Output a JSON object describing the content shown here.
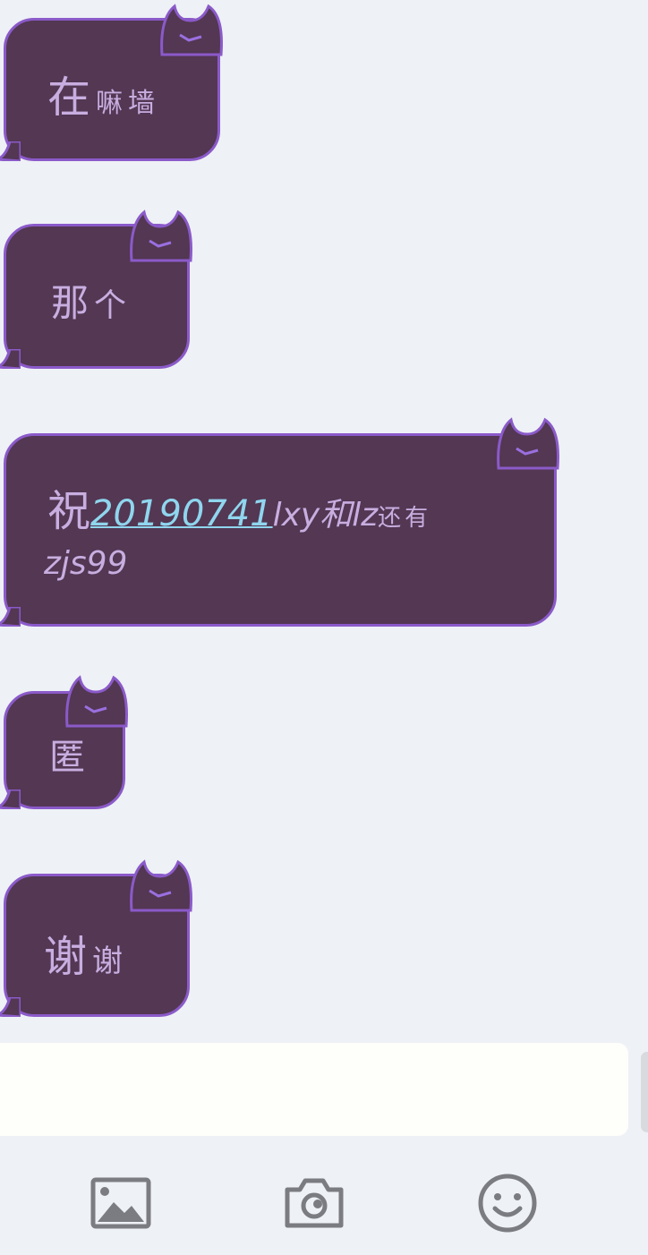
{
  "messages": [
    {
      "id": "m1",
      "big": "在",
      "small": "嘛墙"
    },
    {
      "id": "m2",
      "big": "那",
      "small": "个"
    },
    {
      "id": "m3",
      "big": "祝",
      "link": "20190741",
      "mid": "lxy和lz",
      "small": "还有",
      "line2": "zjs99"
    },
    {
      "id": "m4",
      "big": "",
      "small": "匿"
    },
    {
      "id": "m5",
      "big": "谢",
      "small": "谢"
    }
  ],
  "input": {
    "value": "",
    "placeholder": ""
  },
  "toolbar": {
    "buttons": [
      {
        "name": "image",
        "icon": "image-icon"
      },
      {
        "name": "camera",
        "icon": "camera-icon"
      },
      {
        "name": "emoji",
        "icon": "smiley-icon"
      }
    ]
  },
  "colors": {
    "background": "#eef1f6",
    "bubble_fill": "#533753",
    "bubble_border": "#8b5ac9",
    "bubble_text": "#c8aee0",
    "link": "#8fd6ee",
    "icon": "#7a7c82"
  }
}
